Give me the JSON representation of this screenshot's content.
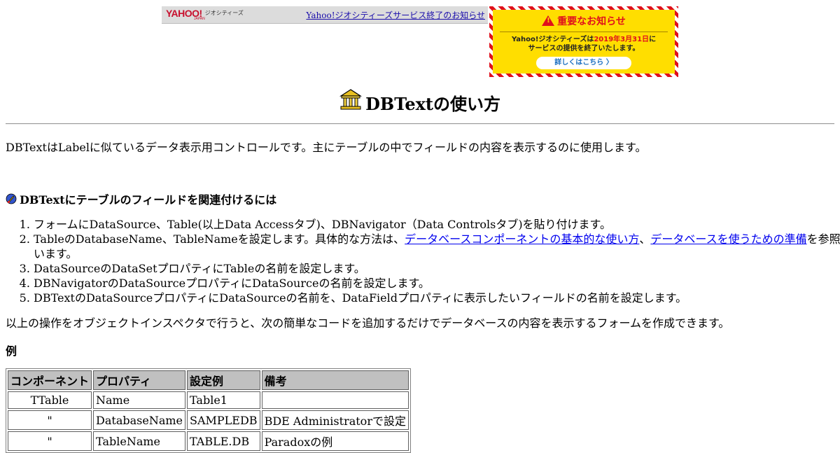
{
  "yahoo_bar": {
    "logo_text": "YAHOO!",
    "logo_sub": "ジオシティーズ",
    "logo_japan": "JAPAN",
    "notice_link": "Yahoo!ジオシティーズサービス終了のお知らせ"
  },
  "notice": {
    "title": "重要なお知らせ",
    "line1_pre": "Yahoo!ジオシティーズは",
    "line1_date": "2019年3月31日",
    "line1_post": "に",
    "line2": "サービスの提供を終了いたします。",
    "button": "詳しくはこちら 〉"
  },
  "title": "DBTextの使い方",
  "intro": "DBTextはLabelに似ているデータ表示用コントロールです。主にテーブルの中でフィールドの内容を表示するのに使用します。",
  "section": {
    "heading": "DBTextにテーブルのフィールドを関連付けるには",
    "steps": {
      "s1": "フォームにDataSource、Table(以上Data Accessタブ)、DBNavigator（Data Controlsタブ)を貼り付けます。",
      "s2_pre": "TableのDatabaseName、TableNameを設定します。具体的な方法は、",
      "s2_link1": "データベースコンポーネントの基本的な使い方",
      "s2_sep": "、",
      "s2_link2": "データベースを使うための準備",
      "s2_post": "を参照願います。",
      "s3": "DataSourceのDataSetプロパティにTableの名前を設定します。",
      "s4": "DBNavigatorのDataSourceプロパティにDataSourceの名前を設定します。",
      "s5": "DBTextのDataSourceプロパティにDataSourceの名前を、DataFieldプロパティに表示したいフィールドの名前を設定します。"
    }
  },
  "paragraph": "以上の操作をオブジェクトインスペクタで行うと、次の簡単なコードを追加するだけでデータベースの内容を表示するフォームを作成できます。",
  "example_label": "例",
  "table": {
    "headers": {
      "h0": "コンポーネント",
      "h1": "プロパティ",
      "h2": "設定例",
      "h3": "備考"
    },
    "rows": [
      {
        "c0": "TTable",
        "c1": "Name",
        "c2": "Table1",
        "c3": ""
      },
      {
        "c0": "\"",
        "c1": "DatabaseName",
        "c2": "SAMPLEDB",
        "c3": "BDE Administratorで設定"
      },
      {
        "c0": "\"",
        "c1": "TableName",
        "c2": "TABLE.DB",
        "c3": "Paradoxの例"
      }
    ]
  },
  "colors": {
    "link": "#0000ee",
    "notice_red": "#e0101c",
    "notice_yellow": "#ffde00"
  }
}
